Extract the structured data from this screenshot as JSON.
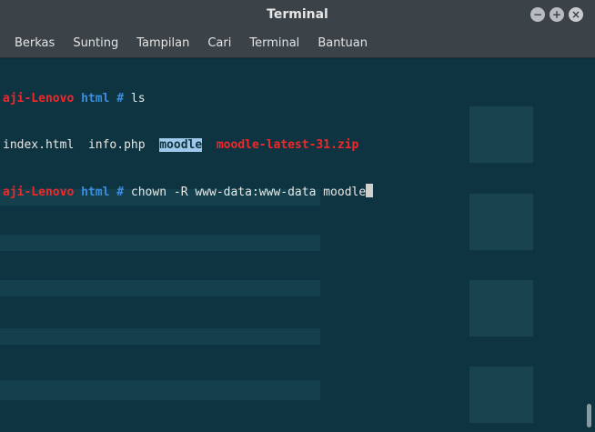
{
  "window": {
    "title": "Terminal",
    "buttons": [
      "−",
      "+",
      "×"
    ]
  },
  "menu": [
    "Berkas",
    "Sunting",
    "Tampilan",
    "Cari",
    "Terminal",
    "Bantuan"
  ],
  "terminal": {
    "line1": {
      "user": "aji-Lenovo",
      "dir": "html",
      "symbol": "#",
      "cmd": "ls"
    },
    "line2": {
      "f1": "index.html",
      "f2": "info.php",
      "f3": "moodle",
      "f4": "moodle-latest-31.zip"
    },
    "line3": {
      "user": "aji-Lenovo",
      "dir": "html",
      "symbol": "#",
      "cmd": "chown -R www-data:www-data moodle"
    }
  },
  "colors": {
    "background": "#0f3441",
    "prompt_user": "#ef2929",
    "prompt_dir": "#3b8ede",
    "archive": "#ef2929",
    "directory_highlight": "#9fc9eb"
  }
}
